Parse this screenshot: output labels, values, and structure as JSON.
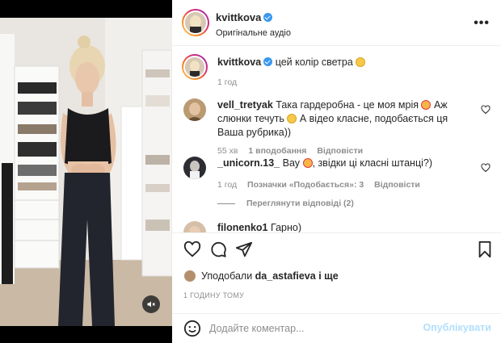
{
  "post": {
    "author": "kvittkova",
    "audio": "Оригінальне аудіо",
    "caption": "цей колір светра",
    "caption_time": "1 год",
    "more_icon": "more-horizontal-icon"
  },
  "comments": [
    {
      "username": "vell_tretyak",
      "text_part1": "Така гардеробна - це моя мрія",
      "text_part2": "Аж слюнки течуть",
      "text_part3": "А відео класне, подобається ця Ваша рубрика))",
      "time": "55 хв",
      "likes": "1 вподобання",
      "reply": "Відповісти"
    },
    {
      "username": "_unicorn.13_",
      "text_part1": "Вау",
      "text_part2": ", звідки ці класні штанці?)",
      "time": "1 год",
      "likes": "Позначки «Подобається»: 3",
      "reply": "Відповісти",
      "view_replies": "Переглянути відповіді (2)"
    },
    {
      "username": "filonenko1",
      "text_part1": "Гарно)"
    }
  ],
  "actions": {
    "liked_by_prefix": "Уподобали",
    "liked_by_user": "da_astafieva",
    "liked_by_suffix": "і ще",
    "timestamp": "1 ГОДИНУ ТОМУ"
  },
  "comment_box": {
    "placeholder": "Додайте коментар...",
    "post_label": "Опублікувати"
  },
  "colors": {
    "accent_blue": "#3897f0",
    "post_disabled": "#b2dffc",
    "muted_text": "#8e8e8e"
  }
}
